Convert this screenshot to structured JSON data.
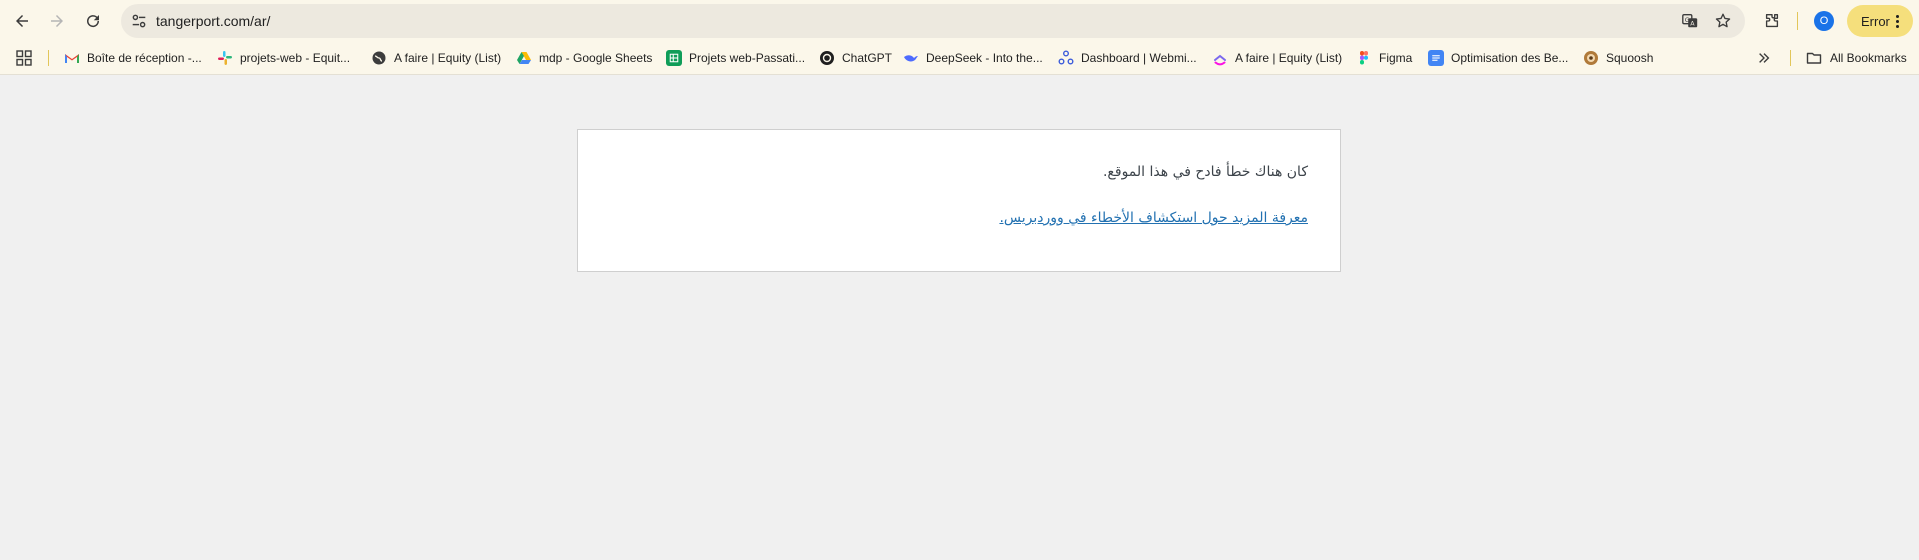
{
  "browser": {
    "url": "tangerport.com/ar/",
    "status_chip": "Error",
    "profile_initial": "O"
  },
  "bookmarks": {
    "items": [
      {
        "label": "Boîte de réception -...",
        "icon": "gmail-icon",
        "color": "#ea4335"
      },
      {
        "label": "projets-web - Equit...",
        "icon": "slack-icon",
        "color": "#e01e5a"
      },
      {
        "label": "A faire | Equity (List)",
        "icon": "globe-icon",
        "color": "#3c3c3c"
      },
      {
        "label": "mdp - Google Sheets",
        "icon": "google-drive-icon",
        "color": "#1fa463"
      },
      {
        "label": "Projets web-Passati...",
        "icon": "google-sheets-icon",
        "color": "#0f9d58"
      },
      {
        "label": "ChatGPT",
        "icon": "chatgpt-icon",
        "color": "#1f1f1f"
      },
      {
        "label": "DeepSeek - Into the...",
        "icon": "deepseek-icon",
        "color": "#4d6bfe"
      },
      {
        "label": "Dashboard | Webmi...",
        "icon": "webmin-icon",
        "color": "#3b5bdb"
      },
      {
        "label": "A faire | Equity (List)",
        "icon": "clickup-icon",
        "color": "#7b68ee"
      },
      {
        "label": "Figma",
        "icon": "figma-icon",
        "color": "#f24e1e"
      },
      {
        "label": "Optimisation des Be...",
        "icon": "google-docs-icon",
        "color": "#4285f4"
      },
      {
        "label": "Squoosh",
        "icon": "squoosh-icon",
        "color": "#b07a3a"
      }
    ],
    "all_bookmarks_label": "All Bookmarks"
  },
  "page": {
    "error_message": "كان هناك خطأ فادح في هذا الموقع.",
    "learn_more_link": "معرفة المزيد حول استكشاف الأخطاء في ووردبريس."
  },
  "colors": {
    "toolbar_bg": "#fbf7ea",
    "error_chip_bg": "#f5df7c",
    "link": "#2271b1",
    "page_bg": "#f0f0f0"
  }
}
